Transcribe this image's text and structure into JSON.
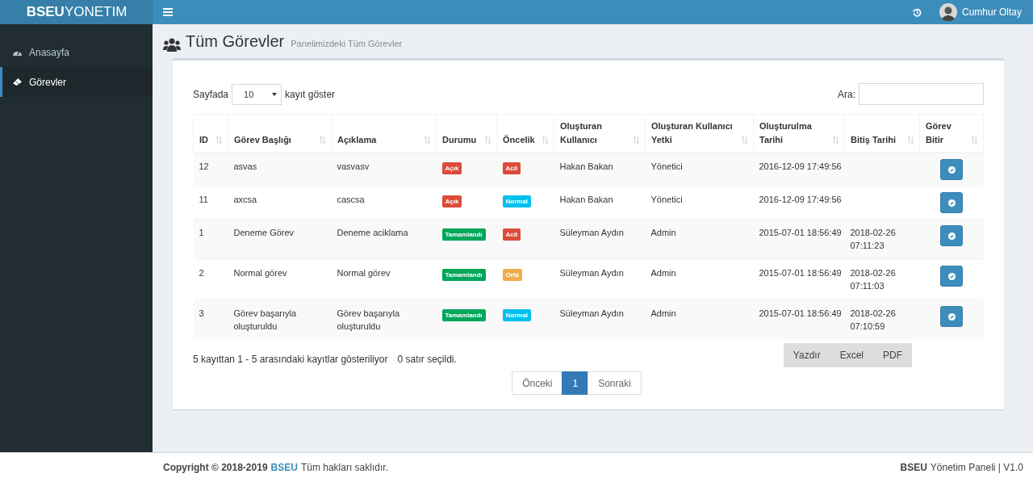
{
  "header": {
    "logo": "**BSEU**YONETIM",
    "user": "Cumhur Oltay"
  },
  "sidebar": {
    "items": [
      {
        "label": "Anasayfa",
        "kind": "dashboard",
        "selected": false
      },
      {
        "label": "Görevler",
        "kind": "ticket",
        "selected": true
      }
    ]
  },
  "page": {
    "title": "Tüm Görevler",
    "subtitle": "Panelimizdeki Tüm Görevler"
  },
  "controls": {
    "length_before": "Sayfada",
    "length_value": "10",
    "length_after": "kayıt göster",
    "search_label": "Ara:"
  },
  "table": {
    "columns": [
      "ID",
      "Görev Başlığı",
      "Açıklama",
      "Durumu",
      "Öncelik",
      "Oluşturan Kullanıcı",
      "Oluşturan Kullanıcı Yetki",
      "Oluşturulma Tarihi",
      "Bitiş Tarihi",
      "Görev Bitir"
    ],
    "rows": [
      {
        "id": "12",
        "title": "asvas",
        "desc": "vasvasv",
        "status": {
          "label": "Açık",
          "color": "#dd4b39"
        },
        "priority": {
          "label": "Acil",
          "color": "#dd4b39"
        },
        "user": "Hakan Bakan",
        "role": "Yönetici",
        "created": "2016-12-09 17:49:56"
      },
      {
        "id": "11",
        "title": "axcsa",
        "desc": "cascsa",
        "status": {
          "label": "Açık",
          "color": "#dd4b39"
        },
        "priority": {
          "label": "Normal",
          "color": "#00c0ef"
        },
        "user": "Hakan Bakan",
        "role": "Yönetici",
        "created": "2016-12-09 17:49:56"
      },
      {
        "id": "1",
        "title": "Deneme Görev",
        "desc": "Deneme aciklama",
        "status": {
          "label": "Tamamlandı",
          "color": "#00a65a"
        },
        "priority": {
          "label": "Acil",
          "color": "#dd4b39"
        },
        "user": "Süleyman Aydın",
        "role": "Admin",
        "created": "2015-07-01 18:56:49",
        "ended": "2018-02-26 07:11:23"
      },
      {
        "id": "2",
        "title": "Normal görev",
        "desc": "Normal görev",
        "status": {
          "label": "Tamamlandı",
          "color": "#00a65a"
        },
        "priority": {
          "label": "Orta",
          "color": "#f0ad4e"
        },
        "user": "Süleyman Aydın",
        "role": "Admin",
        "created": "2015-07-01 18:56:49",
        "ended": "2018-02-26 07:11:03"
      },
      {
        "id": "3",
        "title": "Görev başarıyla oluşturuldu",
        "desc": "Görev başarıyla oluşturuldu",
        "status": {
          "label": "Tamamlandı",
          "color": "#00a65a"
        },
        "priority": {
          "label": "Normal",
          "color": "#00c0ef"
        },
        "user": "Süleyman Aydın",
        "role": "Admin",
        "created": "2015-07-01 18:56:49",
        "ended": "2018-02-26 07:10:59"
      }
    ]
  },
  "info": "5 kayıttan 1 - 5 arasındaki kayıtlar gösteriliyor",
  "selected_info": "0 satır seçildi.",
  "export_buttons": [
    "Yazdır",
    "Excel",
    "PDF"
  ],
  "pagination": [
    {
      "label": "Önceki",
      "selected": false
    },
    {
      "label": "1",
      "selected": true
    },
    {
      "label": "Sonraki",
      "selected": false
    }
  ],
  "footer": {
    "copyright": "Copyright © 2018-2019",
    "brand": "BSEU",
    "rights": "Tüm hakları saklıdır.",
    "right_brand": "BSEU",
    "right_text": "Yönetim Paneli | V1.0"
  }
}
